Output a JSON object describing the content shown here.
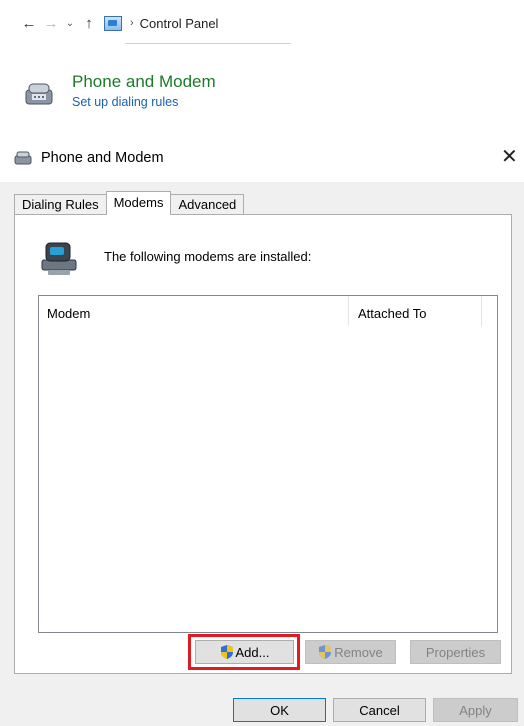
{
  "explorer": {
    "breadcrumb": "Control Panel",
    "back_icon": "←",
    "forward_icon": "→",
    "recent_icon": "⌄",
    "up_icon": "↑",
    "crumb_sep": "›"
  },
  "cp_item": {
    "title": "Phone and Modem",
    "link": "Set up dialing rules"
  },
  "dialog": {
    "title": "Phone and Modem",
    "close": "✕",
    "tabs": [
      {
        "label": "Dialing Rules",
        "active": false
      },
      {
        "label": "Modems",
        "active": true
      },
      {
        "label": "Advanced",
        "active": false
      }
    ],
    "installed_text": "The following modems are installed:",
    "list": {
      "columns": [
        "Modem",
        "Attached To"
      ],
      "rows": []
    },
    "buttons": {
      "add": "Add...",
      "remove": "Remove",
      "properties": "Properties",
      "ok": "OK",
      "cancel": "Cancel",
      "apply": "Apply"
    }
  },
  "colors": {
    "title_green": "#1e7a2a",
    "link_blue": "#1a5fb4",
    "highlight_red": "#e11b22",
    "dialog_bg": "#f0f0f0"
  }
}
